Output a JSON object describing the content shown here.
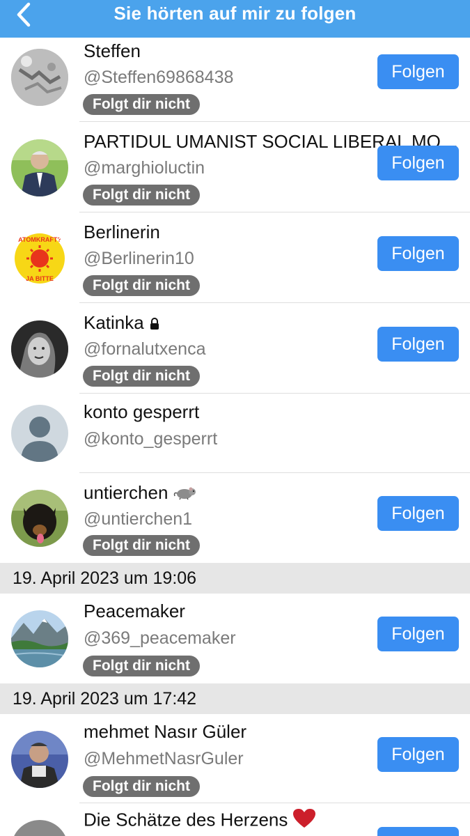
{
  "header": {
    "title": "Sie hörten auf mir zu folgen"
  },
  "follow_label": "Folgen",
  "badge_label": "Folgt dir nicht",
  "users": [
    {
      "name": "Steffen",
      "handle": "@Steffen69868438"
    },
    {
      "name": "PARTIDUL UMANIST SOCIAL LIBERAL MOLDOVA",
      "handle": "@marghioluctin"
    },
    {
      "name": "Berlinerin",
      "handle": "@Berlinerin10",
      "avatar_text_top": "ATOMKRAFT?",
      "avatar_text_bottom": "JA BITTE"
    },
    {
      "name": "Katinka",
      "handle": "@fornalutxenca"
    },
    {
      "name": "konto gesperrt",
      "handle": "@konto_gesperrt"
    },
    {
      "name": "untierchen",
      "handle": "@untierchen1"
    },
    {
      "name": "Peacemaker",
      "handle": "@369_peacemaker"
    },
    {
      "name": "mehmet Nasır Güler",
      "handle": "@MehmetNasrGuler"
    },
    {
      "name": "Die Schätze des Herzens",
      "handle": ""
    }
  ],
  "dates": [
    "19. April 2023 um 19:06",
    "19. April 2023 um 17:42"
  ],
  "colors": {
    "header": "#4ba3ec",
    "button": "#3a8ef2",
    "badge": "#6f6f6f",
    "separator": "#e6e6e6"
  }
}
